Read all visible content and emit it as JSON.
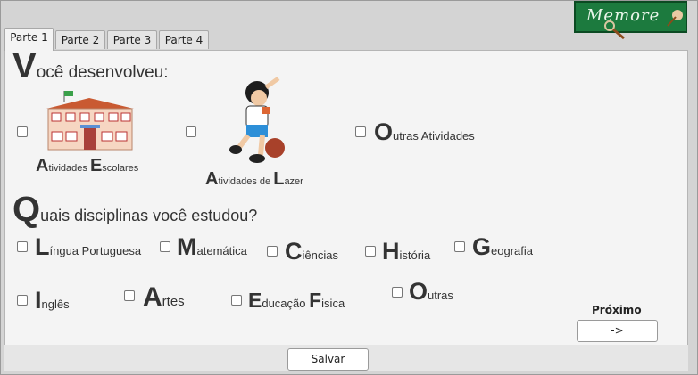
{
  "logo": {
    "text": "Memore"
  },
  "tabs": [
    "Parte 1",
    "Parte 2",
    "Parte 3",
    "Parte 4"
  ],
  "section1": {
    "cap": "V",
    "rest": "ocê desenvolveu:"
  },
  "activities": [
    {
      "cap1": "A",
      "rest1": "tividades ",
      "cap2": "E",
      "rest2": "scolares"
    },
    {
      "cap1": "A",
      "rest1": "tividades de ",
      "cap2": "L",
      "rest2": "azer"
    },
    {
      "cap1": "O",
      "rest1": "utras Atividades"
    }
  ],
  "section2": {
    "cap": "Q",
    "rest": "uais disciplinas você estudou?"
  },
  "subjects": [
    {
      "cap": "L",
      "rest": "íngua  Portuguesa"
    },
    {
      "cap": "M",
      "rest": "atemática"
    },
    {
      "cap": "C",
      "rest": "iências"
    },
    {
      "cap": "H",
      "rest": "istória"
    },
    {
      "cap": "G",
      "rest": "eografia"
    },
    {
      "cap": "I",
      "rest": "nglês"
    },
    {
      "cap": "A",
      "rest": "rtes"
    },
    {
      "cap": "E",
      "rest": "ducação ",
      "cap2": "F",
      "rest2": "isica"
    },
    {
      "cap": "O",
      "rest": "utras"
    }
  ],
  "next": {
    "label": "Próximo",
    "button": "->"
  },
  "save_label": "Salvar"
}
